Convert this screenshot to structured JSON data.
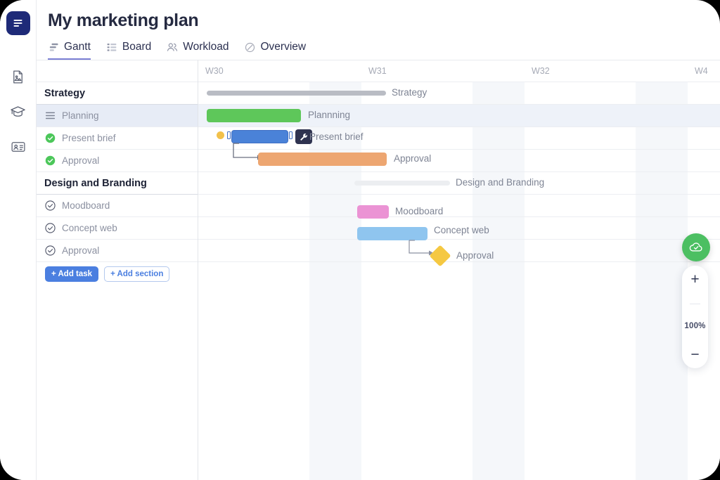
{
  "app": {
    "rail_icons": [
      {
        "name": "app-logo-icon",
        "label": "Project logo"
      },
      {
        "name": "document-image-icon",
        "label": "Documents"
      },
      {
        "name": "graduation-cap-icon",
        "label": "Learning"
      },
      {
        "name": "id-card-icon",
        "label": "Contacts"
      }
    ]
  },
  "header": {
    "title": "My marketing plan",
    "tabs": [
      {
        "label": "Gantt",
        "icon": "gantt-icon",
        "active": true
      },
      {
        "label": "Board",
        "icon": "board-icon",
        "active": false
      },
      {
        "label": "Workload",
        "icon": "people-icon",
        "active": false
      },
      {
        "label": "Overview",
        "icon": "overview-icon",
        "active": false
      }
    ]
  },
  "task_list": {
    "rows": [
      {
        "label": "Strategy",
        "type": "group",
        "icon": null,
        "selected": false
      },
      {
        "label": "Planning",
        "type": "task",
        "icon": "drag-handle-icon",
        "selected": true
      },
      {
        "label": "Present brief",
        "type": "task",
        "icon": "check-circle-filled-icon",
        "selected": false
      },
      {
        "label": "Approval",
        "type": "task",
        "icon": "check-circle-filled-icon",
        "selected": false
      },
      {
        "label": "Design and Branding",
        "type": "group",
        "icon": null,
        "selected": false
      },
      {
        "label": "Moodboard",
        "type": "task",
        "icon": "check-circle-outline-icon",
        "selected": false
      },
      {
        "label": "Concept web",
        "type": "task",
        "icon": "check-circle-outline-icon",
        "selected": false
      },
      {
        "label": "Approval",
        "type": "task",
        "icon": "check-circle-outline-icon",
        "selected": false
      }
    ],
    "add_task_label": "+ Add task",
    "add_section_label": "+ Add section"
  },
  "gantt": {
    "week_labels": [
      "W30",
      "W31",
      "W32",
      "W4"
    ],
    "bars": [
      {
        "label": "Strategy",
        "kind": "summary",
        "color": "#b9bcc4"
      },
      {
        "label": "Plannning",
        "kind": "bar",
        "color": "#5ec75a"
      },
      {
        "label": "Present brief",
        "kind": "bar",
        "color": "#4a82d8",
        "selected": true
      },
      {
        "label": "Approval",
        "kind": "bar",
        "color": "#eda671"
      },
      {
        "label": "Design and Branding",
        "kind": "summary",
        "color": "#eceef1"
      },
      {
        "label": "Moodboard",
        "kind": "bar",
        "color": "#eb93d4"
      },
      {
        "label": "Concept web",
        "kind": "bar",
        "color": "#8fc5ef"
      },
      {
        "label": "Approval",
        "kind": "milestone",
        "color": "#f5c842"
      }
    ]
  },
  "controls": {
    "save_icon": "cloud-check-icon",
    "zoom_in_label": "+",
    "zoom_level": "100%",
    "zoom_out_label": "−"
  },
  "colors": {
    "accent": "#4b7fe0",
    "tab_active": "#7b7fd4",
    "save_green": "#4cbf62",
    "selected_row": "#e7ecf6"
  }
}
